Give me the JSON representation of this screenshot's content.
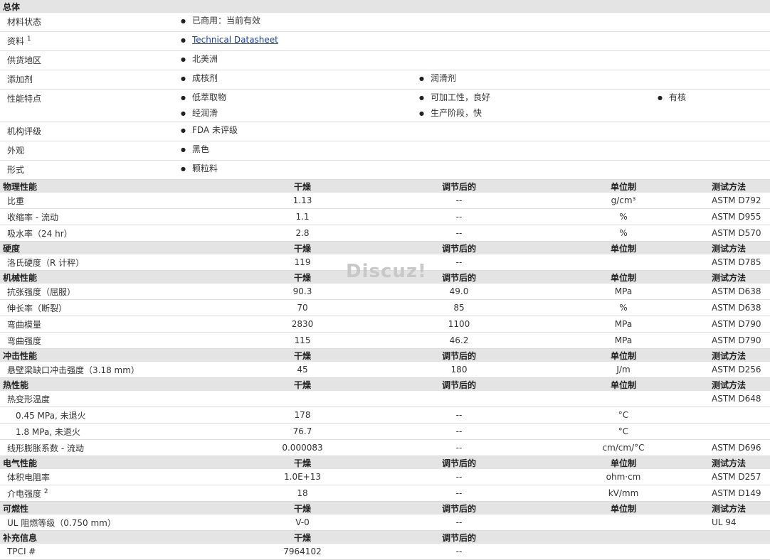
{
  "general": {
    "title": "总体",
    "rows": [
      {
        "label": "材料状态",
        "cols": [
          [
            "已商用：当前有效"
          ]
        ]
      },
      {
        "label": "资料",
        "sup": "1",
        "link": "Technical Datasheet"
      },
      {
        "label": "供货地区",
        "cols": [
          [
            "北美洲"
          ]
        ]
      },
      {
        "label": "添加剂",
        "cols": [
          [
            "成核剂"
          ],
          [
            "润滑剂"
          ]
        ]
      },
      {
        "label": "性能特点",
        "cols": [
          [
            "低萃取物",
            "经润滑"
          ],
          [
            "可加工性，良好",
            "生产阶段，快"
          ],
          [
            "有核"
          ]
        ]
      },
      {
        "label": "机构评级",
        "cols": [
          [
            "FDA 未评级"
          ]
        ]
      },
      {
        "label": "外观",
        "cols": [
          [
            "黑色"
          ]
        ]
      },
      {
        "label": "形式",
        "cols": [
          [
            "颗粒料"
          ]
        ]
      }
    ]
  },
  "headers": {
    "dry": "干燥",
    "cond": "调节后的",
    "unit": "单位制",
    "method": "测试方法"
  },
  "sections": [
    {
      "title": "物理性能",
      "rows": [
        {
          "name": "比重",
          "dry": "1.13",
          "cond": "--",
          "unit": "g/cm³",
          "method": "ASTM D792"
        },
        {
          "name": "收缩率 - 流动",
          "dry": "1.1",
          "cond": "--",
          "unit": "%",
          "method": "ASTM D955"
        },
        {
          "name": "吸水率（24 hr）",
          "dry": "2.8",
          "cond": "--",
          "unit": "%",
          "method": "ASTM D570"
        }
      ]
    },
    {
      "title": "硬度",
      "rows": [
        {
          "name": "洛氏硬度（R 计秤）",
          "dry": "119",
          "cond": "--",
          "unit": "",
          "method": "ASTM D785"
        }
      ]
    },
    {
      "title": "机械性能",
      "rows": [
        {
          "name": "抗张强度（屈服）",
          "dry": "90.3",
          "cond": "49.0",
          "unit": "MPa",
          "method": "ASTM D638"
        },
        {
          "name": "伸长率（断裂）",
          "dry": "70",
          "cond": "85",
          "unit": "%",
          "method": "ASTM D638"
        },
        {
          "name": "弯曲模量",
          "dry": "2830",
          "cond": "1100",
          "unit": "MPa",
          "method": "ASTM D790"
        },
        {
          "name": "弯曲强度",
          "dry": "115",
          "cond": "46.2",
          "unit": "MPa",
          "method": "ASTM D790"
        }
      ]
    },
    {
      "title": "冲击性能",
      "rows": [
        {
          "name": "悬壁梁缺口冲击强度（3.18 mm）",
          "dry": "45",
          "cond": "180",
          "unit": "J/m",
          "method": "ASTM D256"
        }
      ]
    },
    {
      "title": "热性能",
      "rows": [
        {
          "name": "热变形温度",
          "dry": "",
          "cond": "",
          "unit": "",
          "method": "ASTM D648"
        },
        {
          "name": "0.45 MPa, 未退火",
          "indent": true,
          "dry": "178",
          "cond": "--",
          "unit": "°C",
          "method": ""
        },
        {
          "name": "1.8 MPa, 未退火",
          "indent": true,
          "dry": "76.7",
          "cond": "--",
          "unit": "°C",
          "method": ""
        },
        {
          "name": "线形膨胀系数 - 流动",
          "dry": "0.000083",
          "cond": "--",
          "unit": "cm/cm/°C",
          "method": "ASTM D696"
        }
      ]
    },
    {
      "title": "电气性能",
      "rows": [
        {
          "name": "体积电阻率",
          "dry": "1.0E+13",
          "cond": "--",
          "unit": "ohm·cm",
          "method": "ASTM D257"
        },
        {
          "name": "介电强度",
          "sup": "2",
          "dry": "18",
          "cond": "--",
          "unit": "kV/mm",
          "method": "ASTM D149"
        }
      ]
    },
    {
      "title": "可燃性",
      "rows": [
        {
          "name": "UL 阻燃等级（0.750 mm）",
          "dry": "V-0",
          "cond": "--",
          "unit": "",
          "method": "UL 94"
        }
      ]
    },
    {
      "title": "补充信息",
      "short": true,
      "rows": [
        {
          "name": "TPCI #",
          "dry": "7964102",
          "cond": "--",
          "unit": "",
          "method": ""
        }
      ]
    }
  ],
  "watermark": "Discuz!"
}
